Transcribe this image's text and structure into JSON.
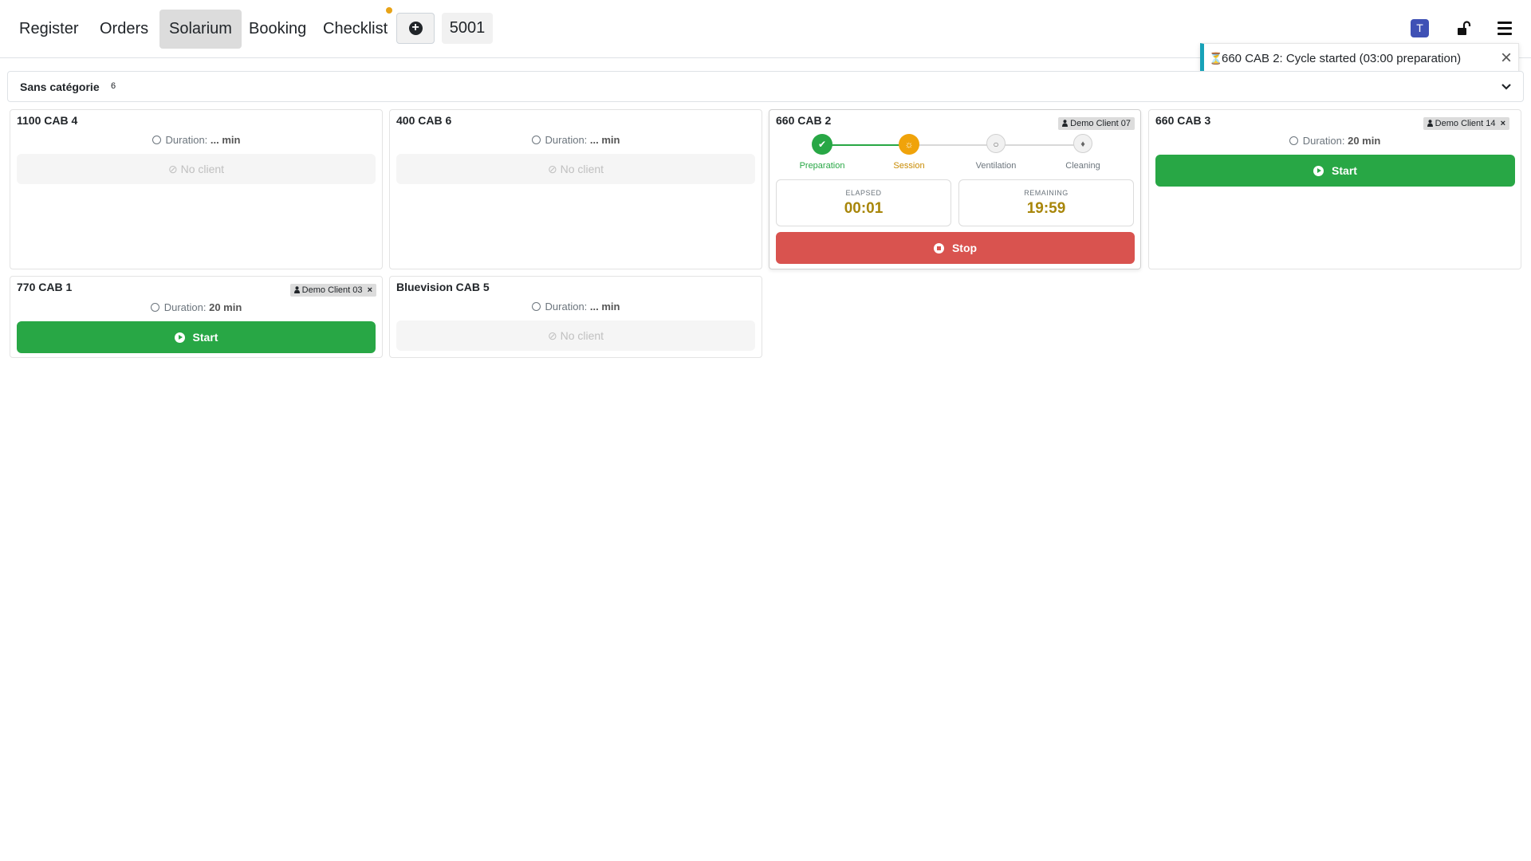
{
  "nav": {
    "tabs": [
      {
        "label": "Register"
      },
      {
        "label": "Orders"
      },
      {
        "label": "Solarium",
        "active": true
      },
      {
        "label": "Booking"
      },
      {
        "label": "Checklist"
      }
    ],
    "table_number": "5001",
    "avatar_letter": "T"
  },
  "toast": {
    "message": "660 CAB 2: Cycle started (03:00 preparation)",
    "close": "×"
  },
  "category": {
    "name": "Sans catégorie",
    "count": "6"
  },
  "labels": {
    "duration": "Duration:",
    "no_client": "No client",
    "start": "Start",
    "stop": "Stop",
    "elapsed": "ELAPSED",
    "remaining": "REMAINING"
  },
  "cabins": [
    {
      "title": "1100 CAB 4",
      "duration": "... min"
    },
    {
      "title": "400 CAB 6",
      "duration": "... min"
    },
    {
      "title": "660 CAB 2",
      "client": "Demo Client 07",
      "steps": [
        "Preparation",
        "Session",
        "Ventilation",
        "Cleaning"
      ],
      "elapsed": "00:01",
      "remaining": "19:59"
    },
    {
      "title": "660 CAB 3",
      "duration": "20 min",
      "client": "Demo Client 14"
    },
    {
      "title": "770 CAB 1",
      "duration": "20 min",
      "client": "Demo Client 03"
    },
    {
      "title": "Bluevision CAB 5",
      "duration": "... min"
    }
  ],
  "colors": {
    "accent_green": "#28a745",
    "stop_red": "#d9534f",
    "session_orange": "#f0a30a",
    "toast_info": "#17a2b8",
    "timer_gold": "#a8860a"
  }
}
